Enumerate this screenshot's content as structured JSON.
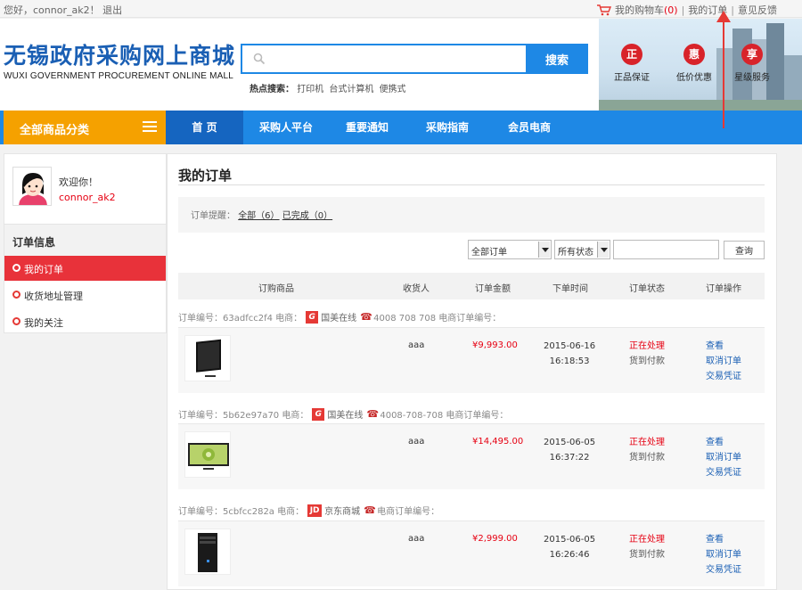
{
  "topbar": {
    "greeting": "您好，",
    "username": "connor_ak2",
    "bang": "！",
    "logout": "退出",
    "cart_label": "我的购物车",
    "cart_count": "(0)",
    "my_orders": "我的订单",
    "feedback": "意见反馈",
    "sep": "|"
  },
  "header": {
    "logo_cn": "无锡政府采购网上商城",
    "logo_en": "WUXI GOVERNMENT PROCUREMENT ONLINE MALL",
    "search_button": "搜索",
    "search_placeholder": "",
    "hot_label": "热点搜索：",
    "hot_items": [
      "打印机",
      "台式计算机",
      "便携式"
    ],
    "badges": [
      {
        "char": "正",
        "label": "正品保证"
      },
      {
        "char": "惠",
        "label": "低价优惠"
      },
      {
        "char": "享",
        "label": "星级服务"
      }
    ]
  },
  "nav": {
    "category": "全部商品分类",
    "items": [
      "首 页",
      "采购人平台",
      "重要通知",
      "采购指南",
      "会员电商"
    ]
  },
  "sidebar": {
    "welcome": "欢迎你！",
    "username": "connor_ak2",
    "section": "订单信息",
    "items": [
      "我的订单",
      "收货地址管理",
      "我的关注"
    ]
  },
  "main": {
    "title": "我的订单",
    "reminder_label": "订单提醒：",
    "reminder_all": "全部（6）",
    "reminder_done": "已完成（0）",
    "filter_orders": "全部订单",
    "filter_status": "所有状态",
    "query_button": "查询",
    "columns": [
      "订购商品",
      "收货人",
      "订单金额",
      "下单时间",
      "订单状态",
      "订单操作"
    ]
  },
  "orders": [
    {
      "header_prefix": "订单编号：63adfcc2f4 电商：",
      "shop_logo": "G",
      "shop": "国美在线",
      "phone_text": "4008 708 708 电商订单编号：",
      "receiver": "aaa",
      "amount": "¥9,993.00",
      "date": "2015-06-16",
      "time": "16:18:53",
      "status": "正在处理",
      "pay": "货到付款",
      "ops": [
        "查看",
        "取消订单",
        "交易凭证"
      ],
      "product": "tv"
    },
    {
      "header_prefix": "订单编号：5b62e97a70 电商：",
      "shop_logo": "G",
      "shop": "国美在线",
      "phone_text": "4008-708-708 电商订单编号：",
      "receiver": "aaa",
      "amount": "¥14,495.00",
      "date": "2015-06-05",
      "time": "16:37:22",
      "status": "正在处理",
      "pay": "货到付款",
      "ops": [
        "查看",
        "取消订单",
        "交易凭证"
      ],
      "product": "tv-lime"
    },
    {
      "header_prefix": "订单编号：5cbfcc282a 电商：",
      "shop_logo": "JD",
      "shop": "京东商城",
      "phone_text": "电商订单编号：",
      "receiver": "aaa",
      "amount": "¥2,999.00",
      "date": "2015-06-05",
      "time": "16:26:46",
      "status": "正在处理",
      "pay": "货到付款",
      "ops": [
        "查看",
        "取消订单",
        "交易凭证"
      ],
      "product": "pc"
    }
  ],
  "colors": {
    "brand_blue": "#1e88e5",
    "category_orange": "#f5a100",
    "accent_red": "#e60012"
  }
}
